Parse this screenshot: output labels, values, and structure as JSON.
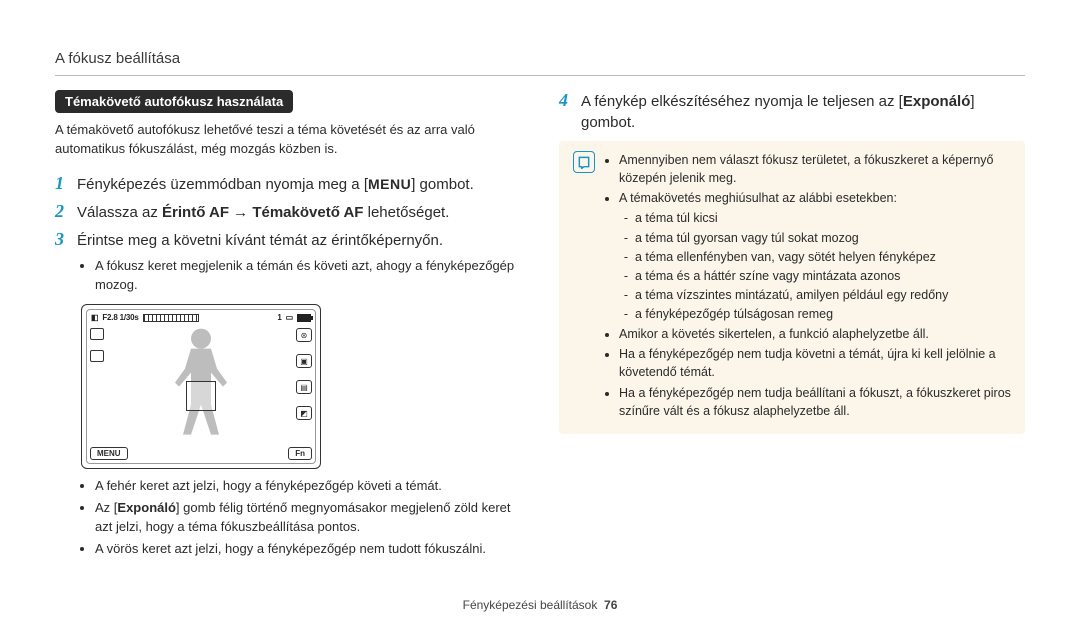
{
  "header": "A fókusz beállítása",
  "left": {
    "pill": "Témakövető autofókusz használata",
    "intro": "A témakövető autofókusz lehetővé teszi a téma követését és az arra való automatikus fókuszálást, még mozgás közben is.",
    "steps": {
      "s1_pre": "Fényképezés üzemmódban nyomja meg a [",
      "s1_menu": "MENU",
      "s1_post": "] gombot.",
      "s2_pre": "Válassza az ",
      "s2_b1": "Érintő AF",
      "s2_arrow": " → ",
      "s2_b2": "Témakövető AF",
      "s2_post": " lehetőséget.",
      "s3": "Érintse meg a követni kívánt témát az érintőképernyőn.",
      "s3_sub": "A fókusz keret megjelenik a témán és követi azt, ahogy a fényképezőgép mozog."
    },
    "lcd": {
      "exposure": "F2.8 1/30s",
      "count": "1",
      "menu": "MENU",
      "fn": "Fn"
    },
    "after": {
      "a1": "A fehér keret azt jelzi, hogy a fényképezőgép követi a témát.",
      "a2_pre": "Az [",
      "a2_b": "Exponáló",
      "a2_post": "] gomb félig történő megnyomásakor megjelenő zöld keret azt jelzi, hogy a téma fókuszbeállítása pontos.",
      "a3": "A vörös keret azt jelzi, hogy a fényképezőgép nem tudott fókuszálni."
    }
  },
  "right": {
    "step4_pre": "A fénykép elkészítéséhez nyomja le teljesen az [",
    "step4_b": "Exponáló",
    "step4_post": "] gombot.",
    "notes": {
      "n1": "Amennyiben nem választ fókusz területet, a fókuszkeret a képernyő közepén jelenik meg.",
      "n2": "A témakövetés meghiúsulhat az alábbi esetekben:",
      "n2_sub": [
        "a téma túl kicsi",
        "a téma túl gyorsan vagy túl sokat mozog",
        "a téma ellenfényben van, vagy sötét helyen fényképez",
        "a téma és a háttér színe vagy mintázata azonos",
        "a téma vízszintes mintázatú, amilyen például egy redőny",
        "a fényképezőgép túlságosan remeg"
      ],
      "n3": "Amikor a követés sikertelen, a funkció alaphelyzetbe áll.",
      "n4": "Ha a fényképezőgép nem tudja követni a témát, újra ki kell jelölnie a követendő témát.",
      "n5": "Ha a fényképezőgép nem tudja beállítani a fókuszt, a fókuszkeret piros színűre vált és a fókusz alaphelyzetbe áll."
    }
  },
  "footer": {
    "label": "Fényképezési beállítások",
    "page": "76"
  }
}
